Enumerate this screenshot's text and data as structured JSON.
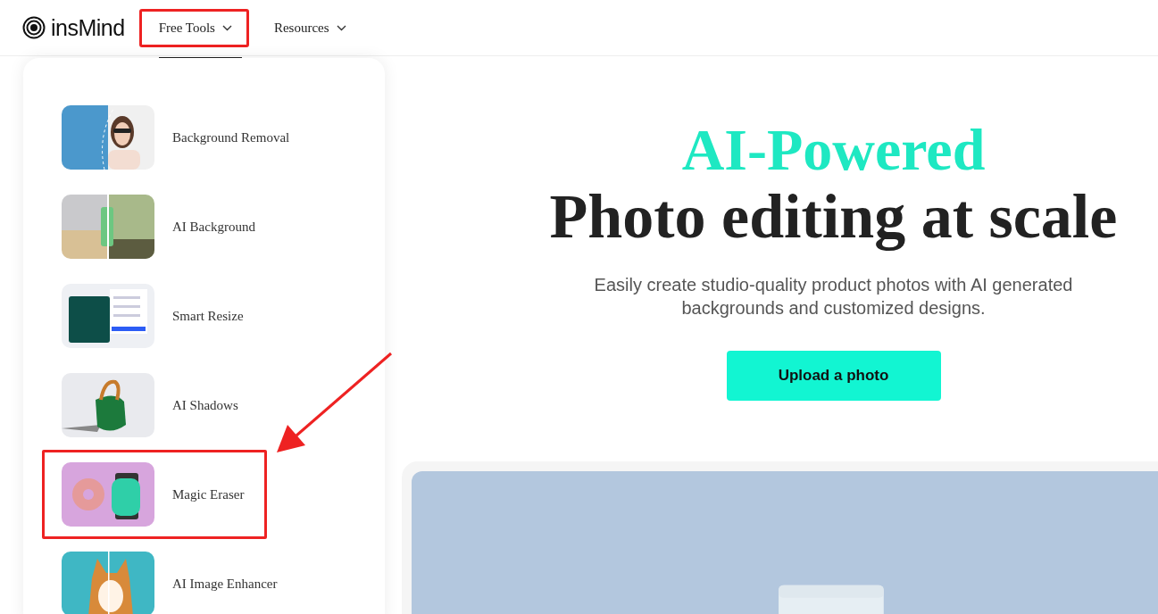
{
  "header": {
    "logo": "insMind",
    "nav": [
      {
        "label": "Free Tools",
        "selected": true,
        "highlighted": true
      },
      {
        "label": "Resources",
        "selected": false,
        "highlighted": false
      }
    ]
  },
  "menu": {
    "items": [
      {
        "label": "Background Removal",
        "highlighted": false,
        "kind": "picture"
      },
      {
        "label": "AI Background",
        "highlighted": false,
        "kind": "picture"
      },
      {
        "label": "Smart Resize",
        "highlighted": false,
        "kind": "picture"
      },
      {
        "label": "AI Shadows",
        "highlighted": false,
        "kind": "picture"
      },
      {
        "label": "Magic Eraser",
        "highlighted": true,
        "kind": "picture"
      },
      {
        "label": "AI Image Enhancer",
        "highlighted": false,
        "kind": "picture"
      }
    ]
  },
  "hero": {
    "accent_title": "AI-Powered",
    "title": "Photo editing at scale",
    "subtitle": "Easily create studio-quality product photos with AI generated backgrounds and customized designs.",
    "button": "Upload a photo"
  },
  "annotation": {
    "arrow": true
  }
}
